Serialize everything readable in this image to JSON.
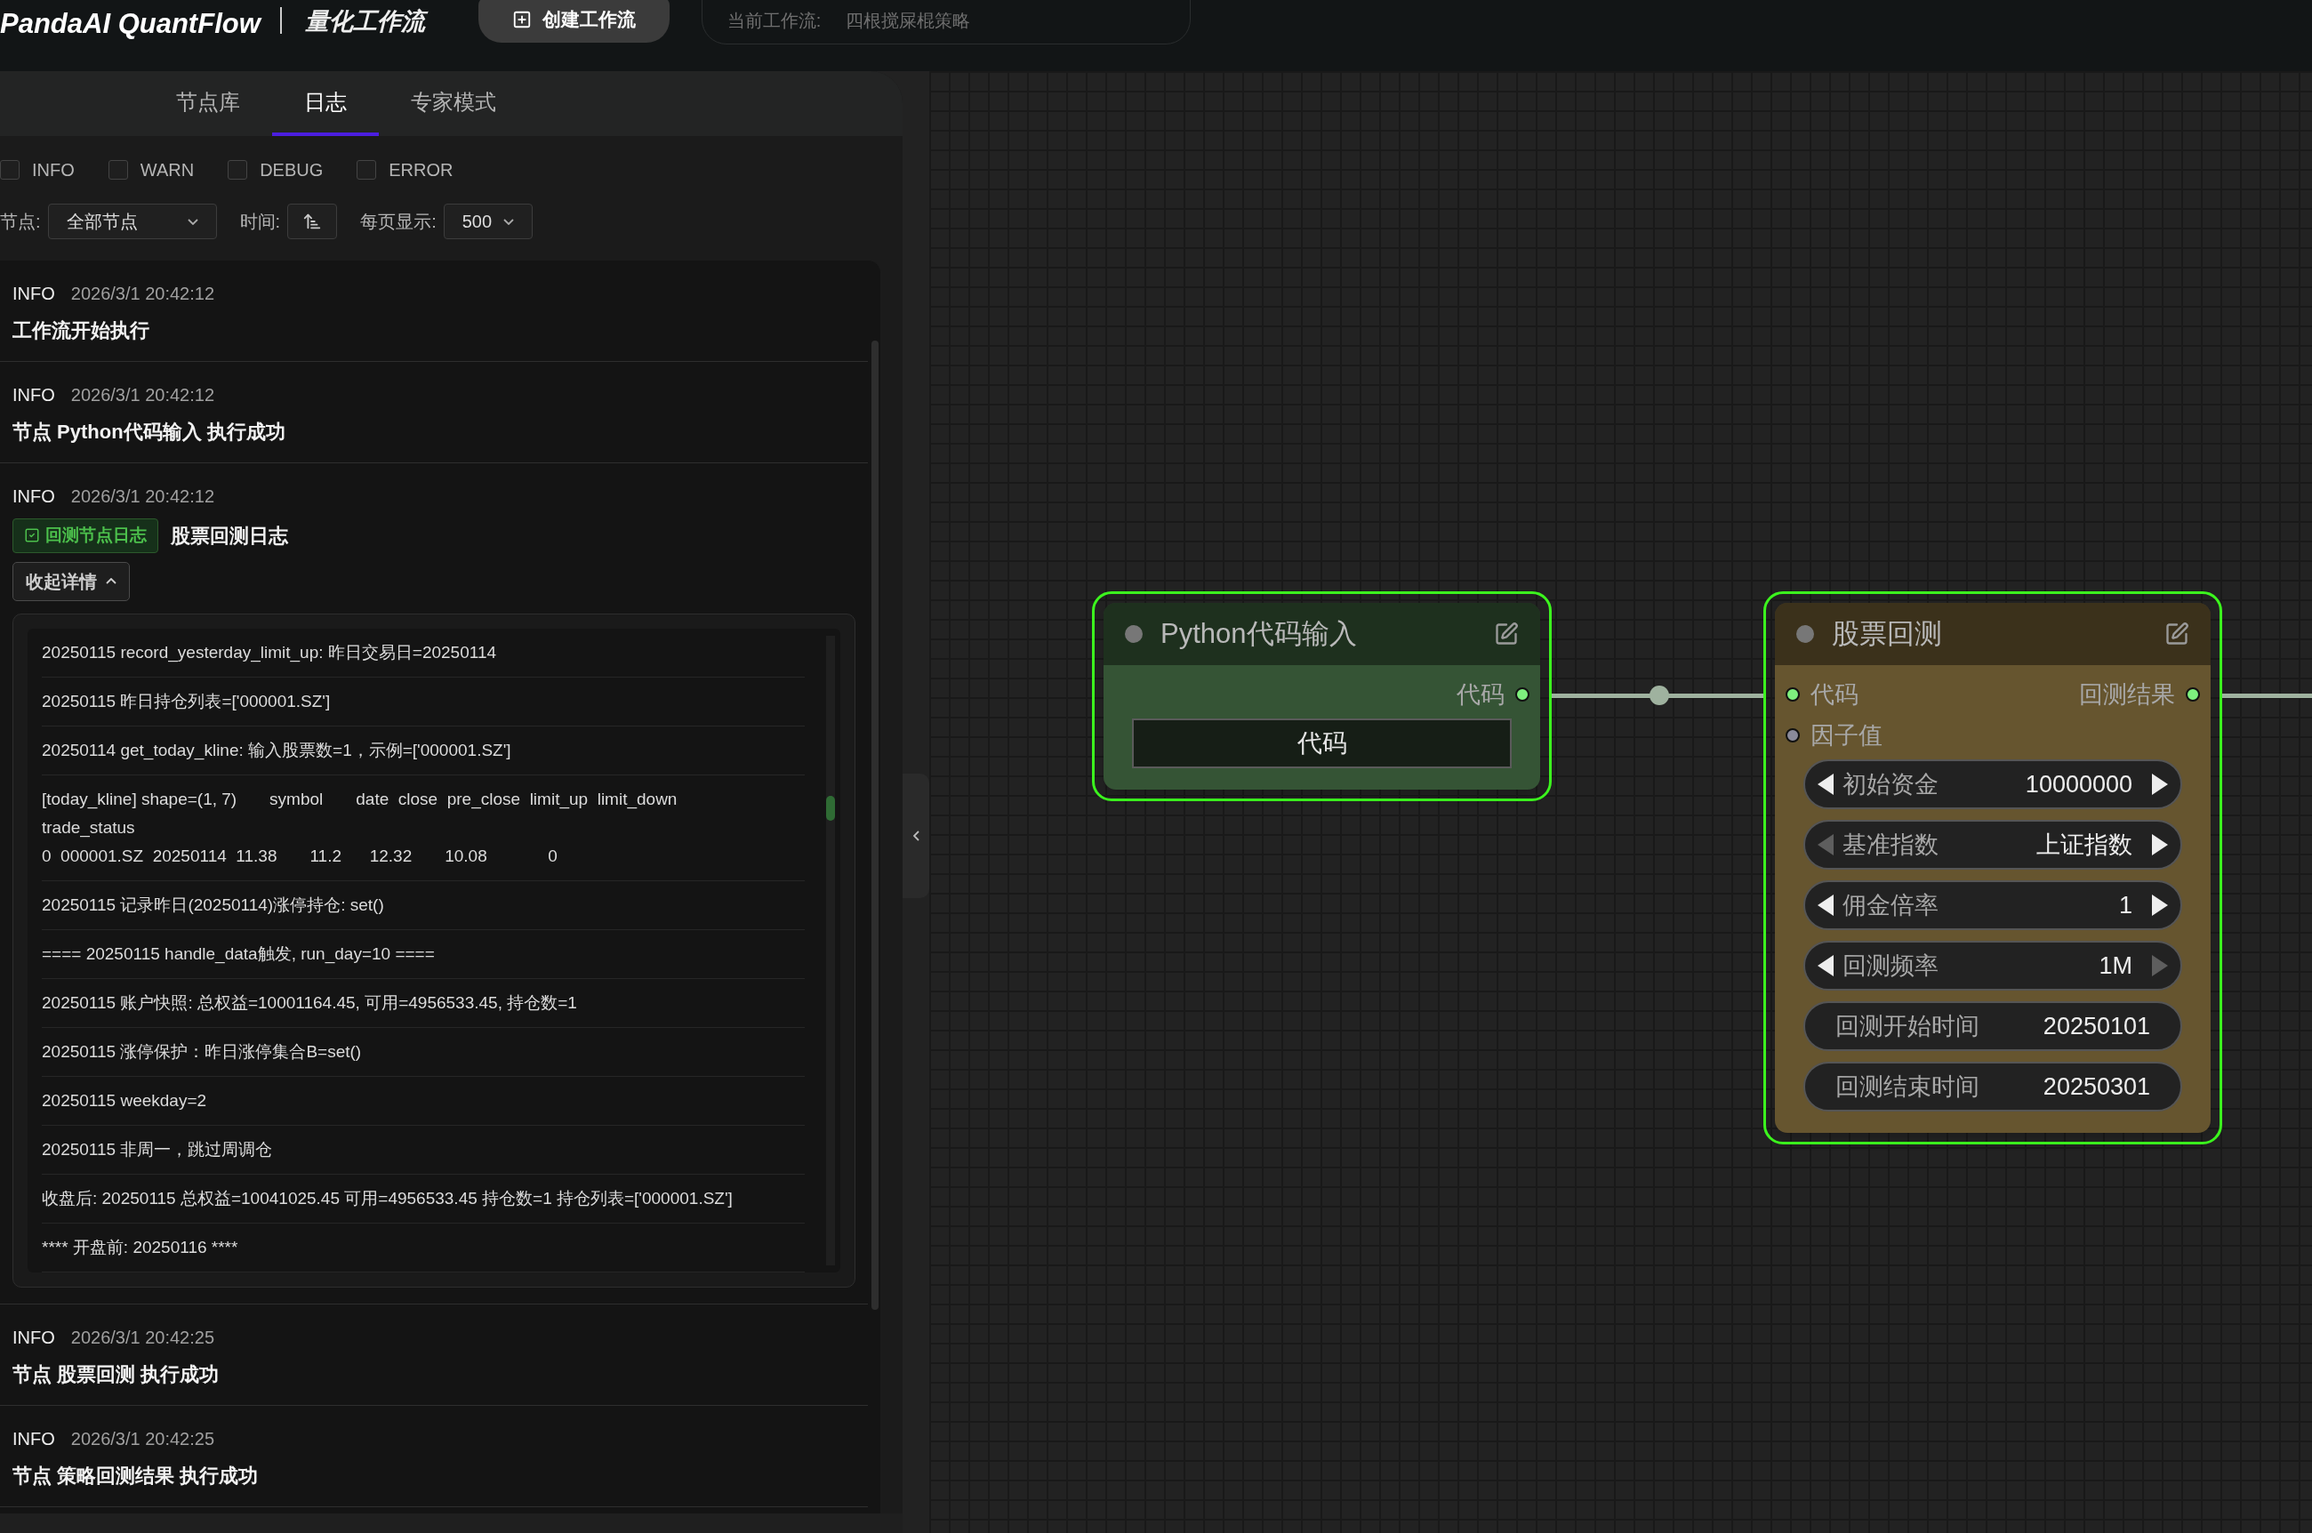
{
  "header": {
    "logo": "PandaAI QuantFlow",
    "subtitle": "量化工作流",
    "create_button": "创建工作流",
    "current_label": "当前工作流:",
    "current_value": "四根搅屎棍策略"
  },
  "tabs": [
    {
      "label": "节点库",
      "selected": false
    },
    {
      "label": "日志",
      "selected": true
    },
    {
      "label": "专家模式",
      "selected": false
    }
  ],
  "level_filters": [
    {
      "label": "INFO",
      "checked": false
    },
    {
      "label": "WARN",
      "checked": false
    },
    {
      "label": "DEBUG",
      "checked": false
    },
    {
      "label": "ERROR",
      "checked": false
    }
  ],
  "filters": {
    "node_label": "节点:",
    "node_value": "全部节点",
    "time_label": "时间:",
    "page_label": "每页显示:",
    "page_value": "500"
  },
  "logs": [
    {
      "level": "INFO",
      "time": "2026/3/1 20:42:12",
      "message": "工作流开始执行"
    },
    {
      "level": "INFO",
      "time": "2026/3/1 20:42:12",
      "message": "节点 Python代码输入 执行成功"
    },
    {
      "level": "INFO",
      "time": "2026/3/1 20:42:12",
      "tag": "回测节点日志",
      "message": "股票回测日志",
      "toggle": "收起详情",
      "expanded": true,
      "details": [
        "20250115 record_yesterday_limit_up: 昨日交易日=20250114",
        "20250115 昨日持仓列表=['000001.SZ']",
        "20250114 get_today_kline: 输入股票数=1，示例=['000001.SZ']",
        "[today_kline] shape=(1, 7)       symbol       date  close  pre_close  limit_up  limit_down\ntrade_status\n0  000001.SZ  20250114  11.38       11.2      12.32       10.08             0",
        "20250115 记录昨日(20250114)涨停持仓: set()",
        "==== 20250115 handle_data触发, run_day=10 ====",
        "20250115 账户快照: 总权益=10001164.45, 可用=4956533.45, 持仓数=1",
        "20250115 涨停保护：昨日涨停集合B=set()",
        "20250115 weekday=2",
        "20250115 非周一，跳过周调仓",
        "收盘后: 20250115 总权益=10041025.45 可用=4956533.45 持仓数=1 持仓列表=['000001.SZ']",
        "**** 开盘前: 20250116 ****"
      ]
    },
    {
      "level": "INFO",
      "time": "2026/3/1 20:42:25",
      "message": "节点 股票回测 执行成功"
    },
    {
      "level": "INFO",
      "time": "2026/3/1 20:42:25",
      "message": "节点 策略回测结果 执行成功"
    }
  ],
  "nodes": [
    {
      "title": "Python代码输入",
      "color": "#355435",
      "selected": true,
      "outputs": [
        {
          "label": "代码",
          "connected": true
        }
      ],
      "widgets": [
        {
          "kind": "button",
          "label": "代码"
        }
      ]
    },
    {
      "title": "股票回测",
      "color": "#66552f",
      "selected": true,
      "inputs": [
        {
          "label": "代码",
          "connected": true
        },
        {
          "label": "因子值",
          "connected": false
        }
      ],
      "outputs": [
        {
          "label": "回测结果",
          "connected": true
        }
      ],
      "widgets": [
        {
          "kind": "stepper",
          "label": "初始资金",
          "value": "10000000",
          "prev_enabled": true,
          "next_enabled": true
        },
        {
          "kind": "stepper",
          "label": "基准指数",
          "value": "上证指数",
          "prev_enabled": false,
          "next_enabled": true
        },
        {
          "kind": "stepper",
          "label": "佣金倍率",
          "value": "1",
          "prev_enabled": true,
          "next_enabled": true
        },
        {
          "kind": "stepper",
          "label": "回测频率",
          "value": "1M",
          "prev_enabled": true,
          "next_enabled": false
        },
        {
          "kind": "text",
          "label": "回测开始时间",
          "value": "20250101"
        },
        {
          "kind": "text",
          "label": "回测结束时间",
          "value": "20250301"
        }
      ]
    }
  ]
}
